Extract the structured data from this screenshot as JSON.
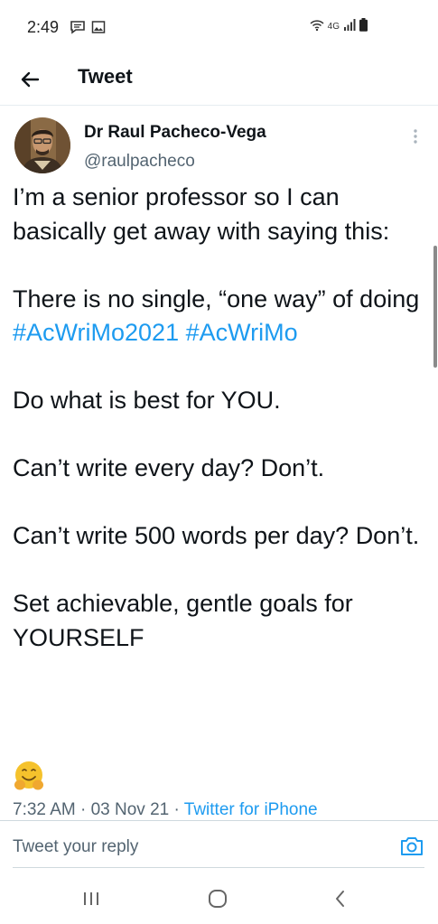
{
  "status_bar": {
    "time": "2:49",
    "network": "4G"
  },
  "header": {
    "title": "Tweet"
  },
  "author": {
    "name": "Dr Raul Pacheco-Vega",
    "handle": "@raulpacheco"
  },
  "tweet": {
    "line1": "I’m a senior professor so I can basically get away with saying this:",
    "line2_prefix": "There is no single, “one way” of doing ",
    "hashtag1": "#AcWriMo2021",
    "hashtag2": "#AcWriMo",
    "line3": "Do what is best for YOU.",
    "line4": "Can’t write every day? Don’t.",
    "line5": "Can’t write 500 words per day? Don’t.",
    "line6": "Set achievable, gentle goals for YOURSELF"
  },
  "meta": {
    "time": "7:32 AM",
    "separator": " · ",
    "date": "03 Nov 21",
    "source": "Twitter for iPhone"
  },
  "reply": {
    "placeholder": "Tweet your reply"
  },
  "colors": {
    "accent": "#1d9bf0",
    "text": "#0f1419",
    "secondary": "#536471",
    "emoji": "#f5c22c"
  }
}
